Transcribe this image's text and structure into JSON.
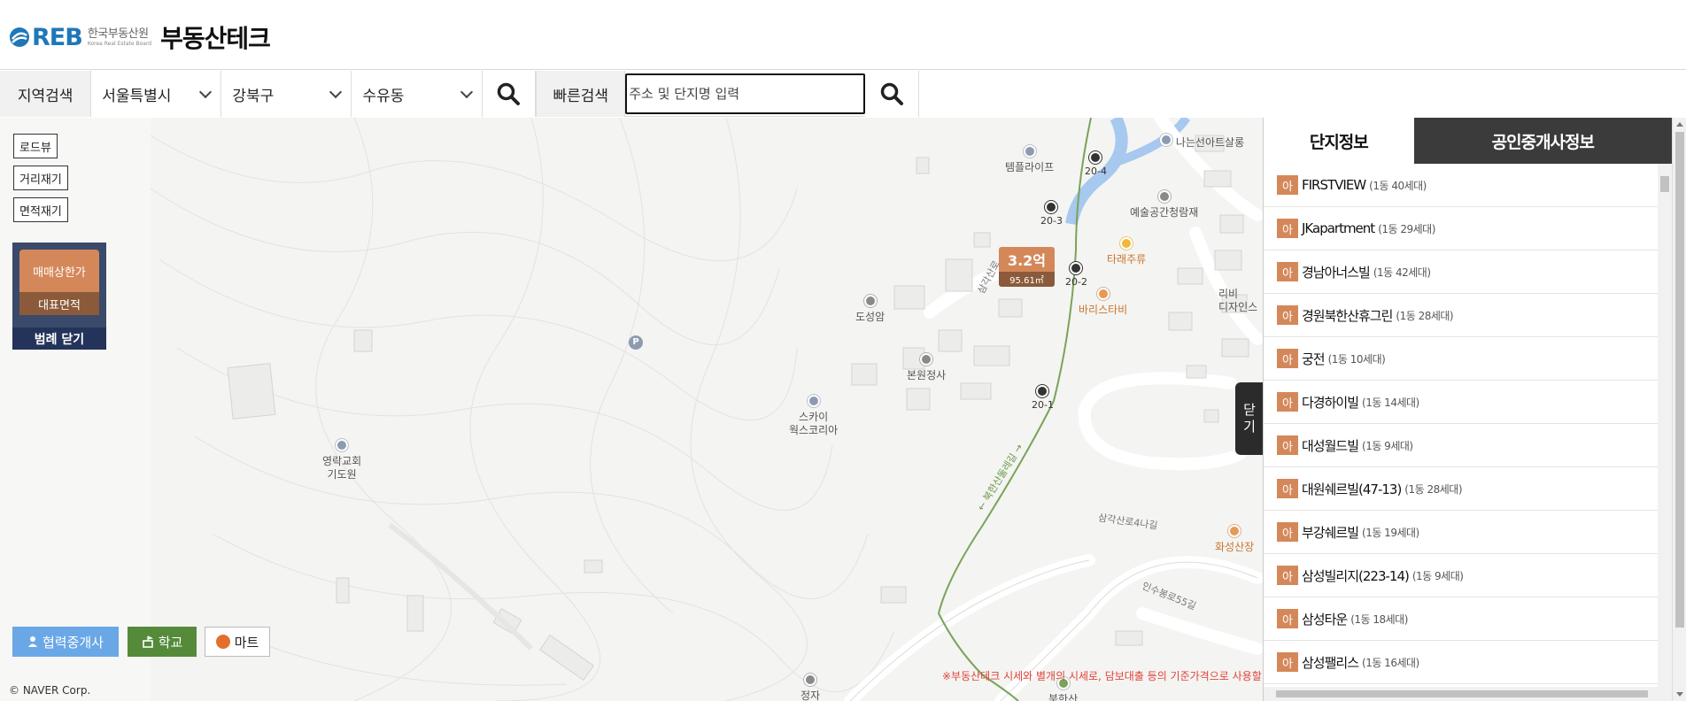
{
  "header": {
    "logo_reb": "REB",
    "logo_korean": "한국부동산원",
    "logo_english": "Korea Real Estate Board",
    "brand": "부동산테크"
  },
  "search": {
    "region_label": "지역검색",
    "city": "서울특별시",
    "district": "강북구",
    "dong": "수유동",
    "quick_label": "빠른검색",
    "quick_placeholder": "주소 및 단지명 입력"
  },
  "map": {
    "tools": {
      "roadview": "로드뷰",
      "distance": "거리재기",
      "area": "면적재기"
    },
    "legend": {
      "price": "매매상한가",
      "area": "대표면적",
      "close": "범례 닫기"
    },
    "bottom_buttons": {
      "agent": "협력중개사",
      "school": "학교",
      "mart": "마트"
    },
    "copyright": "© NAVER Corp.",
    "notice": "※부동산테크 시세와 별개의 시세로, 담보대출 등의 기준가격으로 사용할",
    "price_marker": {
      "price": "3.2억",
      "area": "95.61㎡"
    },
    "pois": {
      "templelife": "템플라이프",
      "nanuseon": "나는선아트살롱",
      "yesul": "예술공간청람재",
      "tarae": "타래주류",
      "baris": "바리스타비",
      "doseongam": "도성암",
      "bonwon": "본원정사",
      "skywax_1": "스카이",
      "skywax_2": "웍스코리아",
      "youngrak_1": "영락교회",
      "youngrak_2": "기도원",
      "hwaseong": "화성산장",
      "design_1": "리비",
      "design_2": "디자인스",
      "parking": "P",
      "jeongja": "정자",
      "bukhansan": "북한산"
    },
    "bus_stops": {
      "s204": "20-4",
      "s203": "20-3",
      "s202": "20-2",
      "s201": "20-1"
    },
    "roads": {
      "r1": "삼각산로4나길",
      "r2": "인수봉로55길",
      "r3": "삼각산로",
      "r4": "← 북한산둘레길 →"
    }
  },
  "panel": {
    "tab_active": "단지정보",
    "tab_inactive": "공인중개사정보",
    "close_label_1": "닫",
    "close_label_2": "기",
    "items": [
      {
        "badge": "아",
        "name": "FIRSTVIEW",
        "info": "(1동 40세대)"
      },
      {
        "badge": "아",
        "name": "JKapartment",
        "info": "(1동 29세대)"
      },
      {
        "badge": "아",
        "name": "경남아너스빌",
        "info": "(1동 42세대)"
      },
      {
        "badge": "아",
        "name": "경원북한산휴그린",
        "info": "(1동 28세대)"
      },
      {
        "badge": "아",
        "name": "궁전",
        "info": "(1동 10세대)"
      },
      {
        "badge": "아",
        "name": "다경하이빌",
        "info": "(1동 14세대)"
      },
      {
        "badge": "아",
        "name": "대성월드빌",
        "info": "(1동 9세대)"
      },
      {
        "badge": "아",
        "name": "대원쉐르빌(47-13)",
        "info": "(1동 28세대)"
      },
      {
        "badge": "아",
        "name": "부강쉐르빌",
        "info": "(1동 19세대)"
      },
      {
        "badge": "아",
        "name": "삼성빌리지(223-14)",
        "info": "(1동 9세대)"
      },
      {
        "badge": "아",
        "name": "삼성타운",
        "info": "(1동 18세대)"
      },
      {
        "badge": "아",
        "name": "삼성팰리스",
        "info": "(1동 16세대)"
      }
    ]
  }
}
